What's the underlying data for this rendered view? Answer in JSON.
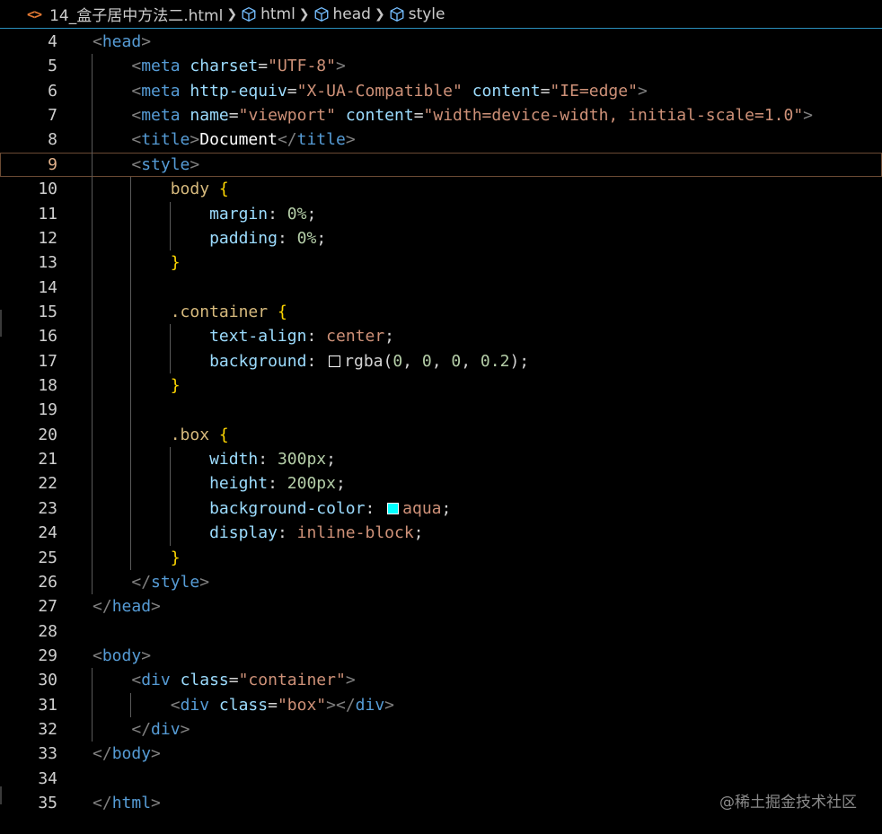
{
  "breadcrumb": {
    "file_icon": "<>",
    "file_name": "14_盒子居中方法二.html",
    "items": [
      "html",
      "head",
      "style"
    ]
  },
  "colors": {
    "rgba_swatch": "rgba(0,0,0,0.2)",
    "aqua_swatch": "#00ffff",
    "accent": "#2b8fbd"
  },
  "editor": {
    "current_line": 9,
    "lines": [
      {
        "n": 4,
        "indent": 0,
        "tokens": [
          [
            "br",
            "<"
          ],
          [
            "tag",
            "head"
          ],
          [
            "br",
            ">"
          ]
        ]
      },
      {
        "n": 5,
        "indent": 1,
        "tokens": [
          [
            "br",
            "<"
          ],
          [
            "tag",
            "meta"
          ],
          [
            "punc",
            " "
          ],
          [
            "attr",
            "charset"
          ],
          [
            "punc",
            "="
          ],
          [
            "str",
            "\"UTF-8\""
          ],
          [
            "br",
            ">"
          ]
        ]
      },
      {
        "n": 6,
        "indent": 1,
        "tokens": [
          [
            "br",
            "<"
          ],
          [
            "tag",
            "meta"
          ],
          [
            "punc",
            " "
          ],
          [
            "attr",
            "http-equiv"
          ],
          [
            "punc",
            "="
          ],
          [
            "str",
            "\"X-UA-Compatible\""
          ],
          [
            "punc",
            " "
          ],
          [
            "attr",
            "content"
          ],
          [
            "punc",
            "="
          ],
          [
            "str",
            "\"IE=edge\""
          ],
          [
            "br",
            ">"
          ]
        ]
      },
      {
        "n": 7,
        "indent": 1,
        "tokens": [
          [
            "br",
            "<"
          ],
          [
            "tag",
            "meta"
          ],
          [
            "punc",
            " "
          ],
          [
            "attr",
            "name"
          ],
          [
            "punc",
            "="
          ],
          [
            "str",
            "\"viewport\""
          ],
          [
            "punc",
            " "
          ],
          [
            "attr",
            "content"
          ],
          [
            "punc",
            "="
          ],
          [
            "str",
            "\"width=device-width, initial-scale=1.0\""
          ],
          [
            "br",
            ">"
          ]
        ]
      },
      {
        "n": 8,
        "indent": 1,
        "tokens": [
          [
            "br",
            "<"
          ],
          [
            "tag",
            "title"
          ],
          [
            "br",
            ">"
          ],
          [
            "text",
            "Document"
          ],
          [
            "br",
            "</"
          ],
          [
            "tag",
            "title"
          ],
          [
            "br",
            ">"
          ]
        ]
      },
      {
        "n": 9,
        "indent": 1,
        "tokens": [
          [
            "br",
            "<"
          ],
          [
            "tag",
            "style"
          ],
          [
            "br",
            ">"
          ]
        ]
      },
      {
        "n": 10,
        "indent": 2,
        "tokens": [
          [
            "sel",
            "body"
          ],
          [
            "punc",
            " "
          ],
          [
            "brace",
            "{"
          ]
        ]
      },
      {
        "n": 11,
        "indent": 3,
        "tokens": [
          [
            "prop",
            "margin"
          ],
          [
            "punc",
            ": "
          ],
          [
            "num",
            "0%"
          ],
          [
            "punc",
            ";"
          ]
        ]
      },
      {
        "n": 12,
        "indent": 3,
        "tokens": [
          [
            "prop",
            "padding"
          ],
          [
            "punc",
            ": "
          ],
          [
            "num",
            "0%"
          ],
          [
            "punc",
            ";"
          ]
        ]
      },
      {
        "n": 13,
        "indent": 2,
        "tokens": [
          [
            "brace",
            "}"
          ]
        ]
      },
      {
        "n": 14,
        "indent": 2,
        "tokens": []
      },
      {
        "n": 15,
        "indent": 2,
        "tokens": [
          [
            "sel",
            ".container"
          ],
          [
            "punc",
            " "
          ],
          [
            "brace",
            "{"
          ]
        ]
      },
      {
        "n": 16,
        "indent": 3,
        "tokens": [
          [
            "prop",
            "text-align"
          ],
          [
            "punc",
            ": "
          ],
          [
            "val",
            "center"
          ],
          [
            "punc",
            ";"
          ]
        ]
      },
      {
        "n": 17,
        "indent": 3,
        "tokens": [
          [
            "prop",
            "background"
          ],
          [
            "punc",
            ": "
          ],
          [
            "swatch",
            "rgba_swatch"
          ],
          [
            "punc",
            "rgba("
          ],
          [
            "num",
            "0"
          ],
          [
            "punc",
            ", "
          ],
          [
            "num",
            "0"
          ],
          [
            "punc",
            ", "
          ],
          [
            "num",
            "0"
          ],
          [
            "punc",
            ", "
          ],
          [
            "num",
            "0.2"
          ],
          [
            "punc",
            ");"
          ]
        ]
      },
      {
        "n": 18,
        "indent": 2,
        "tokens": [
          [
            "brace",
            "}"
          ]
        ]
      },
      {
        "n": 19,
        "indent": 2,
        "tokens": []
      },
      {
        "n": 20,
        "indent": 2,
        "tokens": [
          [
            "sel",
            ".box"
          ],
          [
            "punc",
            " "
          ],
          [
            "brace",
            "{"
          ]
        ]
      },
      {
        "n": 21,
        "indent": 3,
        "tokens": [
          [
            "prop",
            "width"
          ],
          [
            "punc",
            ": "
          ],
          [
            "num",
            "300px"
          ],
          [
            "punc",
            ";"
          ]
        ]
      },
      {
        "n": 22,
        "indent": 3,
        "tokens": [
          [
            "prop",
            "height"
          ],
          [
            "punc",
            ": "
          ],
          [
            "num",
            "200px"
          ],
          [
            "punc",
            ";"
          ]
        ]
      },
      {
        "n": 23,
        "indent": 3,
        "tokens": [
          [
            "prop",
            "background-color"
          ],
          [
            "punc",
            ": "
          ],
          [
            "swatch",
            "aqua_swatch"
          ],
          [
            "val",
            "aqua"
          ],
          [
            "punc",
            ";"
          ]
        ]
      },
      {
        "n": 24,
        "indent": 3,
        "tokens": [
          [
            "prop",
            "display"
          ],
          [
            "punc",
            ": "
          ],
          [
            "val",
            "inline-block"
          ],
          [
            "punc",
            ";"
          ]
        ]
      },
      {
        "n": 25,
        "indent": 2,
        "tokens": [
          [
            "brace",
            "}"
          ]
        ]
      },
      {
        "n": 26,
        "indent": 1,
        "tokens": [
          [
            "br",
            "</"
          ],
          [
            "tag",
            "style"
          ],
          [
            "br",
            ">"
          ]
        ]
      },
      {
        "n": 27,
        "indent": 0,
        "tokens": [
          [
            "br",
            "</"
          ],
          [
            "tag",
            "head"
          ],
          [
            "br",
            ">"
          ]
        ]
      },
      {
        "n": 28,
        "indent": 0,
        "tokens": []
      },
      {
        "n": 29,
        "indent": 0,
        "tokens": [
          [
            "br",
            "<"
          ],
          [
            "tag",
            "body"
          ],
          [
            "br",
            ">"
          ]
        ]
      },
      {
        "n": 30,
        "indent": 1,
        "tokens": [
          [
            "br",
            "<"
          ],
          [
            "tag",
            "div"
          ],
          [
            "punc",
            " "
          ],
          [
            "attr",
            "class"
          ],
          [
            "punc",
            "="
          ],
          [
            "str",
            "\"container\""
          ],
          [
            "br",
            ">"
          ]
        ]
      },
      {
        "n": 31,
        "indent": 2,
        "tokens": [
          [
            "br",
            "<"
          ],
          [
            "tag",
            "div"
          ],
          [
            "punc",
            " "
          ],
          [
            "attr",
            "class"
          ],
          [
            "punc",
            "="
          ],
          [
            "str",
            "\"box\""
          ],
          [
            "br",
            "></"
          ],
          [
            "tag",
            "div"
          ],
          [
            "br",
            ">"
          ]
        ]
      },
      {
        "n": 32,
        "indent": 1,
        "tokens": [
          [
            "br",
            "</"
          ],
          [
            "tag",
            "div"
          ],
          [
            "br",
            ">"
          ]
        ]
      },
      {
        "n": 33,
        "indent": 0,
        "tokens": [
          [
            "br",
            "</"
          ],
          [
            "tag",
            "body"
          ],
          [
            "br",
            ">"
          ]
        ]
      },
      {
        "n": 34,
        "indent": 0,
        "tokens": []
      },
      {
        "n": 35,
        "indent": 0,
        "tokens": [
          [
            "br",
            "</"
          ],
          [
            "tag",
            "html"
          ],
          [
            "br",
            ">"
          ]
        ]
      }
    ]
  },
  "watermark": "@稀土掘金技术社区"
}
